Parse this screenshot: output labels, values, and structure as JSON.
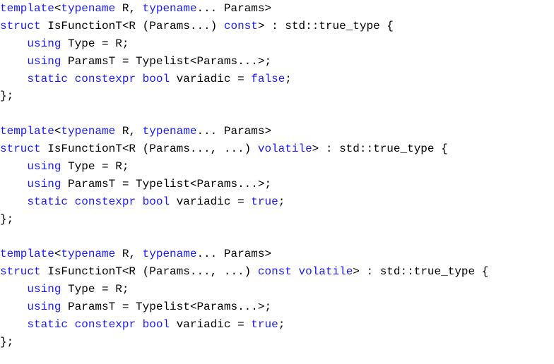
{
  "colors": {
    "keyword": "#1a1aff",
    "text": "#000000",
    "background": "#ffffff"
  },
  "code_lines": [
    [
      {
        "t": "template",
        "k": true
      },
      {
        "t": "<",
        "k": false
      },
      {
        "t": "typename",
        "k": true
      },
      {
        "t": " R, ",
        "k": false
      },
      {
        "t": "typename",
        "k": true
      },
      {
        "t": "... Params>",
        "k": false
      }
    ],
    [
      {
        "t": "struct",
        "k": true
      },
      {
        "t": " IsFunctionT<R (Params...) ",
        "k": false
      },
      {
        "t": "const",
        "k": true
      },
      {
        "t": "> : std::true_type {",
        "k": false
      }
    ],
    [
      {
        "t": "    ",
        "k": false
      },
      {
        "t": "using",
        "k": true
      },
      {
        "t": " Type = R;",
        "k": false
      }
    ],
    [
      {
        "t": "    ",
        "k": false
      },
      {
        "t": "using",
        "k": true
      },
      {
        "t": " ParamsT = Typelist<Params...>;",
        "k": false
      }
    ],
    [
      {
        "t": "    ",
        "k": false
      },
      {
        "t": "static",
        "k": true
      },
      {
        "t": " ",
        "k": false
      },
      {
        "t": "constexpr",
        "k": true
      },
      {
        "t": " ",
        "k": false
      },
      {
        "t": "bool",
        "k": true
      },
      {
        "t": " variadic = ",
        "k": false
      },
      {
        "t": "false",
        "k": true
      },
      {
        "t": ";",
        "k": false
      }
    ],
    [
      {
        "t": "};",
        "k": false
      }
    ],
    [],
    [
      {
        "t": "template",
        "k": true
      },
      {
        "t": "<",
        "k": false
      },
      {
        "t": "typename",
        "k": true
      },
      {
        "t": " R, ",
        "k": false
      },
      {
        "t": "typename",
        "k": true
      },
      {
        "t": "... Params>",
        "k": false
      }
    ],
    [
      {
        "t": "struct",
        "k": true
      },
      {
        "t": " IsFunctionT<R (Params..., ...) ",
        "k": false
      },
      {
        "t": "volatile",
        "k": true
      },
      {
        "t": "> : std::true_type {",
        "k": false
      }
    ],
    [
      {
        "t": "    ",
        "k": false
      },
      {
        "t": "using",
        "k": true
      },
      {
        "t": " Type = R;",
        "k": false
      }
    ],
    [
      {
        "t": "    ",
        "k": false
      },
      {
        "t": "using",
        "k": true
      },
      {
        "t": " ParamsT = Typelist<Params...>;",
        "k": false
      }
    ],
    [
      {
        "t": "    ",
        "k": false
      },
      {
        "t": "static",
        "k": true
      },
      {
        "t": " ",
        "k": false
      },
      {
        "t": "constexpr",
        "k": true
      },
      {
        "t": " ",
        "k": false
      },
      {
        "t": "bool",
        "k": true
      },
      {
        "t": " variadic = ",
        "k": false
      },
      {
        "t": "true",
        "k": true
      },
      {
        "t": ";",
        "k": false
      }
    ],
    [
      {
        "t": "};",
        "k": false
      }
    ],
    [],
    [
      {
        "t": "template",
        "k": true
      },
      {
        "t": "<",
        "k": false
      },
      {
        "t": "typename",
        "k": true
      },
      {
        "t": " R, ",
        "k": false
      },
      {
        "t": "typename",
        "k": true
      },
      {
        "t": "... Params>",
        "k": false
      }
    ],
    [
      {
        "t": "struct",
        "k": true
      },
      {
        "t": " IsFunctionT<R (Params..., ...) ",
        "k": false
      },
      {
        "t": "const",
        "k": true
      },
      {
        "t": " ",
        "k": false
      },
      {
        "t": "volatile",
        "k": true
      },
      {
        "t": "> : std::true_type {",
        "k": false
      }
    ],
    [
      {
        "t": "    ",
        "k": false
      },
      {
        "t": "using",
        "k": true
      },
      {
        "t": " Type = R;",
        "k": false
      }
    ],
    [
      {
        "t": "    ",
        "k": false
      },
      {
        "t": "using",
        "k": true
      },
      {
        "t": " ParamsT = Typelist<Params...>;",
        "k": false
      }
    ],
    [
      {
        "t": "    ",
        "k": false
      },
      {
        "t": "static",
        "k": true
      },
      {
        "t": " ",
        "k": false
      },
      {
        "t": "constexpr",
        "k": true
      },
      {
        "t": " ",
        "k": false
      },
      {
        "t": "bool",
        "k": true
      },
      {
        "t": " variadic = ",
        "k": false
      },
      {
        "t": "true",
        "k": true
      },
      {
        "t": ";",
        "k": false
      }
    ],
    [
      {
        "t": "};",
        "k": false
      }
    ]
  ]
}
